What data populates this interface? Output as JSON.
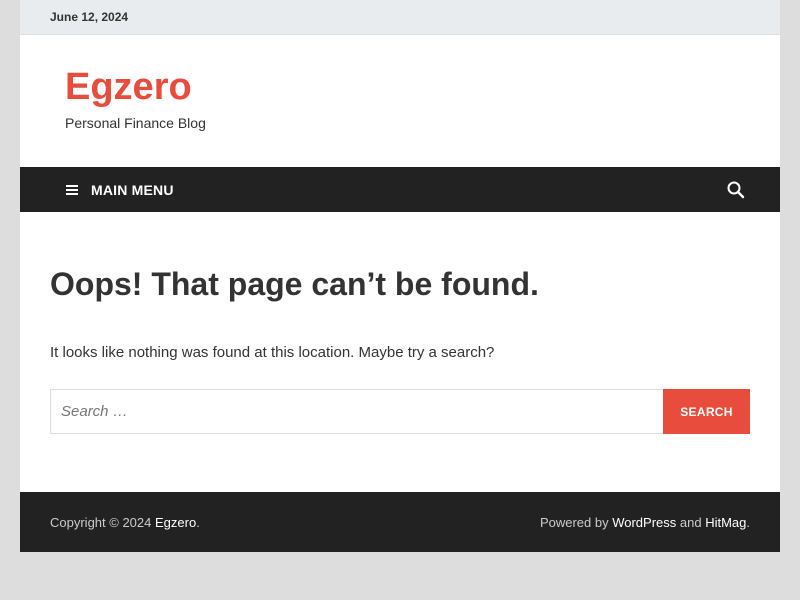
{
  "topbar": {
    "date": "June 12, 2024"
  },
  "site": {
    "title": "Egzero",
    "tagline": "Personal Finance Blog"
  },
  "nav": {
    "menu_label": "MAIN MENU",
    "menu_icon": "hamburger-icon",
    "search_icon": "search-icon"
  },
  "content": {
    "title": "Oops! That page can’t be found.",
    "message": "It looks like nothing was found at this location. Maybe try a search?",
    "search_placeholder": "Search …",
    "search_value": "",
    "search_button": "SEARCH"
  },
  "footer": {
    "copyright_prefix": "Copyright © 2024 ",
    "copyright_link": "Egzero",
    "copyright_suffix": ".",
    "powered_prefix": "Powered by ",
    "powered_link1": "WordPress",
    "powered_mid": " and ",
    "powered_link2": "HitMag",
    "powered_suffix": "."
  },
  "colors": {
    "accent": "#e74c3c",
    "dark_bar": "#222222",
    "topbar_bg": "#e9ecee",
    "page_bg": "#dddddd",
    "text": "#333333"
  }
}
